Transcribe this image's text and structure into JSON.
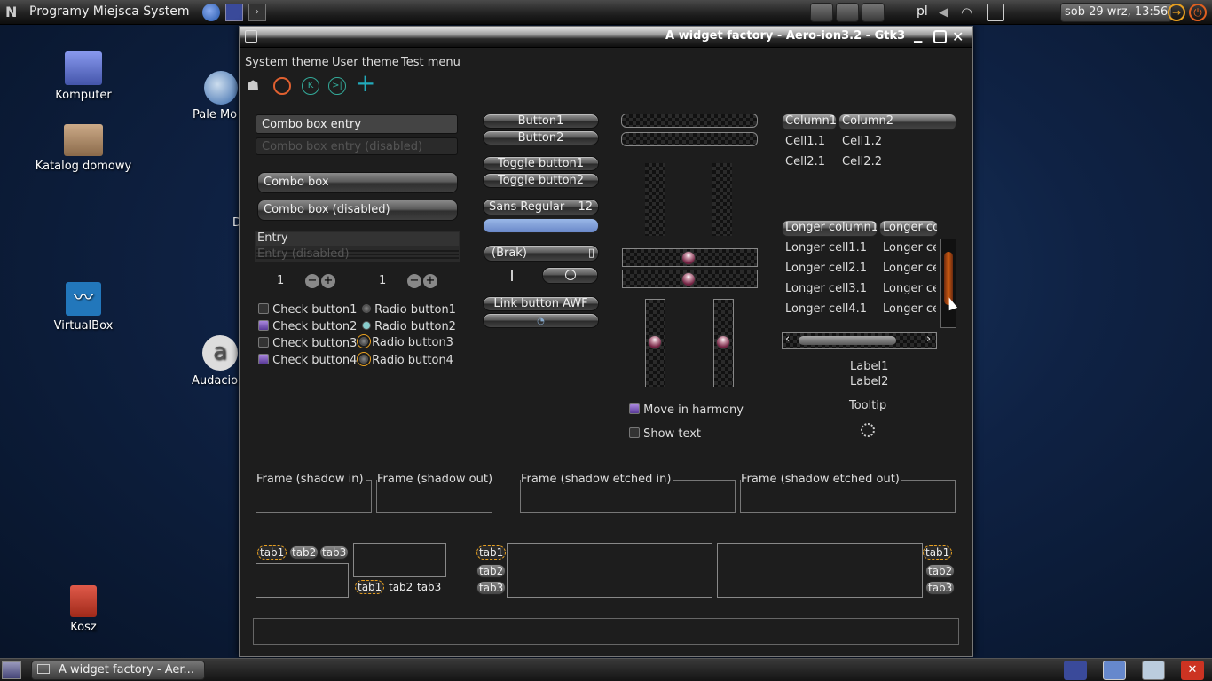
{
  "topbar": {
    "menu_label": "Programy Miejsca System",
    "lang": "pl",
    "clock": "sob 29 wrz, 13:56"
  },
  "desktop": {
    "icons": [
      {
        "label": "Komputer"
      },
      {
        "label": "Pale Mo"
      },
      {
        "label": "Katalog domowy"
      },
      {
        "label": "D"
      },
      {
        "label": "VirtualBox"
      },
      {
        "label": "Audacio"
      },
      {
        "label": "Kosz"
      }
    ]
  },
  "window": {
    "title": "A widget factory - Aero-ion3.2 - Gtk3",
    "menu": [
      "System theme",
      "User theme",
      "Test menu"
    ],
    "combo_entry": "Combo box entry",
    "combo_entry_disabled": "Combo box entry (disabled)",
    "combo": "Combo box",
    "combo_disabled": "Combo box (disabled)",
    "entry": "Entry",
    "entry_disabled": "Entry (disabled)",
    "spin1": "1",
    "spin2": "1",
    "checks": [
      "Check button1",
      "Check button2",
      "Check button3",
      "Check button4"
    ],
    "radios": [
      "Radio button1",
      "Radio button2",
      "Radio button3",
      "Radio button4"
    ],
    "buttons": [
      "Button1",
      "Button2"
    ],
    "toggles": [
      "Toggle button1",
      "Toggle button2"
    ],
    "font_button": {
      "name": "Sans Regular",
      "size": "12"
    },
    "file_chooser": "(Brak)",
    "link_button": "Link button AWF",
    "move_harmony": "Move in harmony",
    "show_text": "Show text",
    "tree1": {
      "columns": [
        "Column1",
        "Column2"
      ],
      "rows": [
        [
          "Cell1.1",
          "Cell1.2"
        ],
        [
          "Cell2.1",
          "Cell2.2"
        ]
      ]
    },
    "tree2": {
      "columns": [
        "Longer column1",
        "Longer co"
      ],
      "rows": [
        [
          "Longer cell1.1",
          "Longer ce"
        ],
        [
          "Longer cell2.1",
          "Longer ce"
        ],
        [
          "Longer cell3.1",
          "Longer ce"
        ],
        [
          "Longer cell4.1",
          "Longer ce"
        ]
      ]
    },
    "labels": [
      "Label1",
      "Label2"
    ],
    "tooltip": "Tooltip",
    "frames": [
      "Frame (shadow in)",
      "Frame (shadow out)",
      "Frame (shadow etched in)",
      "Frame (shadow etched out)"
    ],
    "tabs": [
      "tab1",
      "tab2",
      "tab3"
    ]
  },
  "taskbar": {
    "task_label": "A widget factory - Aer..."
  }
}
